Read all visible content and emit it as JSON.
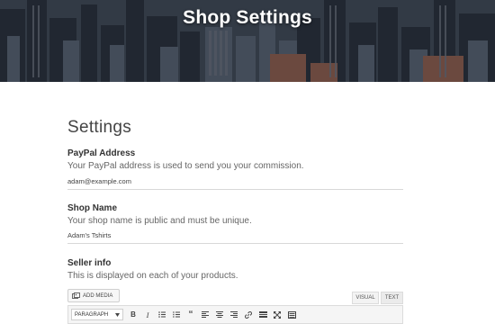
{
  "hero": {
    "title": "Shop Settings"
  },
  "page": {
    "title": "Settings"
  },
  "fields": {
    "paypal": {
      "label": "PayPal Address",
      "description": "Your PayPal address is used to send you your commission.",
      "value": "adam@example.com"
    },
    "shop_name": {
      "label": "Shop Name",
      "description": "Your shop name is public and must be unique.",
      "value": "Adam's Tshirts"
    },
    "seller_info": {
      "label": "Seller info",
      "description": "This is displayed on each of your products."
    }
  },
  "editor": {
    "add_media_label": "ADD MEDIA",
    "tab_visual": "VISUAL",
    "tab_text": "TEXT",
    "format_select": "PARAGRAPH",
    "toolbar_icons": [
      "bold-icon",
      "italic-icon",
      "bulleted-list-icon",
      "numbered-list-icon",
      "blockquote-icon",
      "align-left-icon",
      "align-center-icon",
      "align-right-icon",
      "link-icon",
      "read-more-icon",
      "fullscreen-icon",
      "toolbar-toggle-icon"
    ]
  }
}
